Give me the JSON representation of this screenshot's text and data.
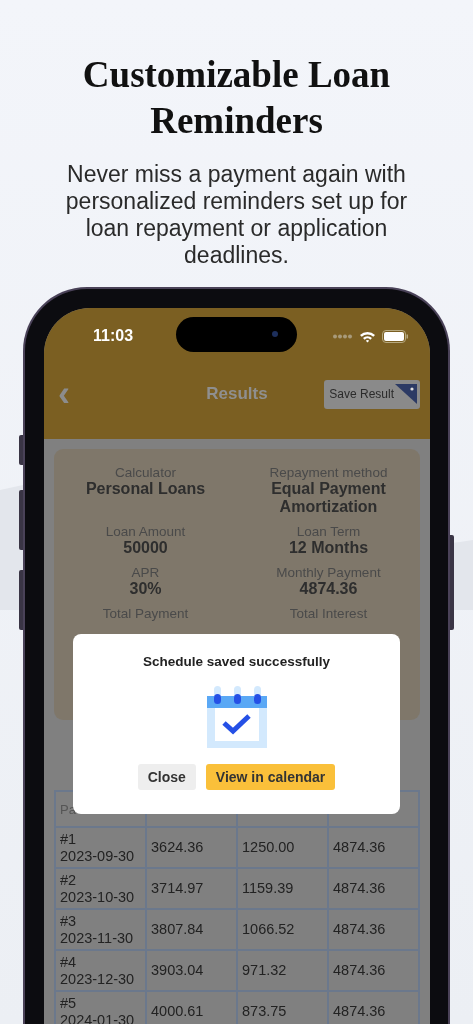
{
  "headline": "Customizable Loan Reminders",
  "subtitle": "Never miss a payment again with personalized reminders set up for loan repayment or application deadlines.",
  "status_bar": {
    "time": "11:03"
  },
  "nav": {
    "back": "‹",
    "title": "Results",
    "action": "Save Result"
  },
  "summary": [
    {
      "label": "Calculator",
      "value": "Personal Loans"
    },
    {
      "label": "Repayment method",
      "value": "Equal Payment Amortization"
    },
    {
      "label": "Loan Amount",
      "value": "50000"
    },
    {
      "label": "Loan Term",
      "value": "12 Months"
    },
    {
      "label": "APR",
      "value": "30%"
    },
    {
      "label": "Monthly Payment",
      "value": "4874.36"
    },
    {
      "label": "Total Payment"
    },
    {
      "label": "Total Interest"
    }
  ],
  "table": {
    "columns": [
      "Pa"
    ],
    "rows": [
      [
        "#1\n2023-09-30",
        "3624.36",
        "1250.00",
        "4874.36"
      ],
      [
        "#2\n2023-10-30",
        "3714.97",
        "1159.39",
        "4874.36"
      ],
      [
        "#3\n2023-11-30",
        "3807.84",
        "1066.52",
        "4874.36"
      ],
      [
        "#4\n2023-12-30",
        "3903.04",
        "971.32",
        "4874.36"
      ],
      [
        "#5\n2024-01-30",
        "4000.61",
        "873.75",
        "4874.36"
      ]
    ]
  },
  "dialog": {
    "title": "Schedule saved successfully",
    "buttons": [
      {
        "label": "Close",
        "kind": "secondary"
      },
      {
        "label": "View in calendar",
        "kind": "primary"
      }
    ]
  }
}
